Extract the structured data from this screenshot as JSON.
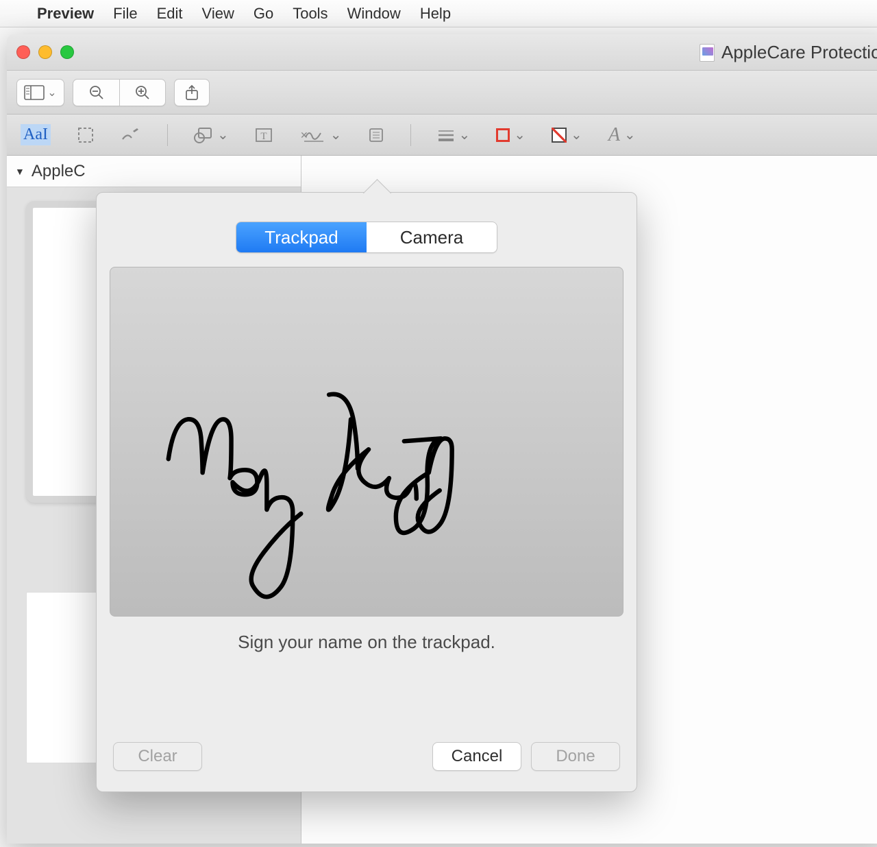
{
  "menubar": {
    "app": "Preview",
    "items": [
      "File",
      "Edit",
      "View",
      "Go",
      "Tools",
      "Window",
      "Help"
    ]
  },
  "window": {
    "title": "AppleCare Protection"
  },
  "toolbar2": {
    "text_style": "AaI"
  },
  "sidebar": {
    "doc_title": "AppleC"
  },
  "popover": {
    "tabs": {
      "trackpad": "Trackpad",
      "camera": "Camera"
    },
    "instruction": "Sign your name on the trackpad.",
    "signature_text": "Molly Katy",
    "buttons": {
      "clear": "Clear",
      "cancel": "Cancel",
      "done": "Done"
    }
  }
}
